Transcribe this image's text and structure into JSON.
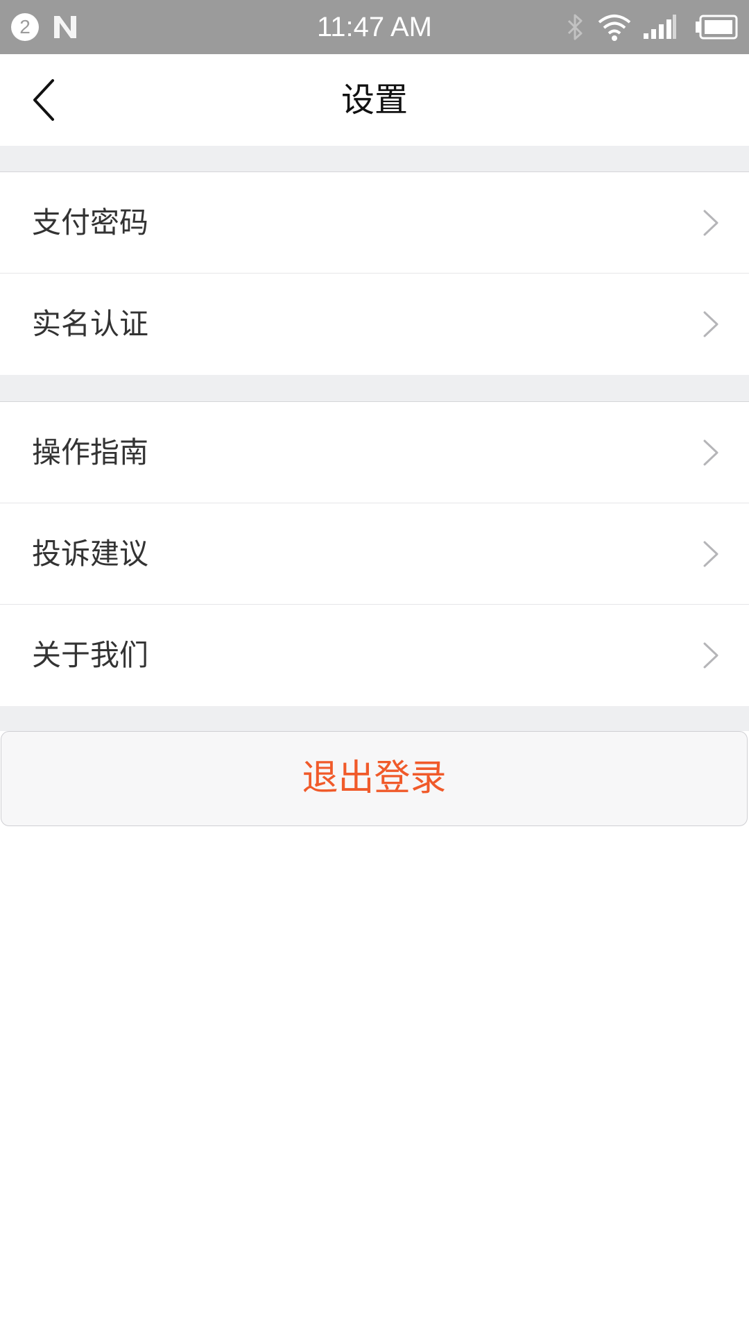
{
  "status_bar": {
    "notification_count": "2",
    "time": "11:47 AM",
    "icons": [
      "notification-badge-icon",
      "n-icon",
      "bluetooth-icon",
      "wifi-icon",
      "signal-icon",
      "battery-icon"
    ]
  },
  "header": {
    "title": "设置",
    "back_icon": "chevron-left-icon"
  },
  "groups": [
    {
      "items": [
        {
          "label": "支付密码"
        },
        {
          "label": "实名认证"
        }
      ]
    },
    {
      "items": [
        {
          "label": "操作指南"
        },
        {
          "label": "投诉建议"
        },
        {
          "label": "关于我们"
        }
      ]
    }
  ],
  "logout": {
    "label": "退出登录"
  },
  "colors": {
    "status_bar_bg": "#9b9b9b",
    "section_gap_bg": "#eeeff1",
    "logout_text": "#f05a2a",
    "chevron": "#b5b5b8"
  }
}
